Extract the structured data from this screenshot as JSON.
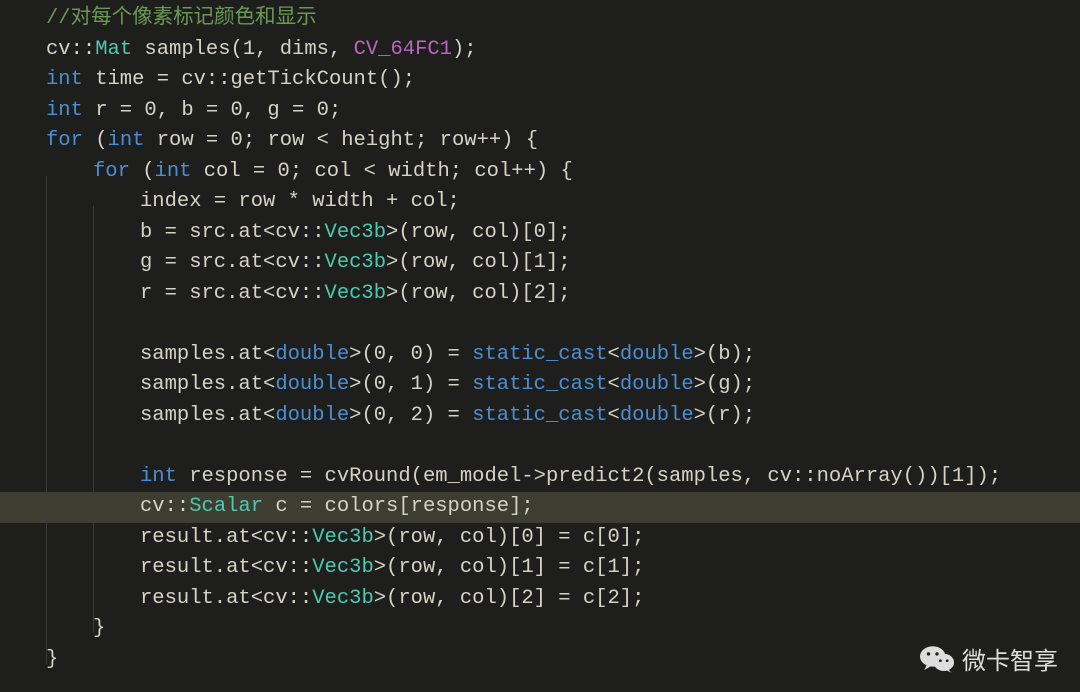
{
  "watermark": "微卡智享",
  "lines": [
    {
      "indent": 1,
      "hl": false,
      "segs": [
        {
          "c": "tok-comment",
          "t": "//对每个像素标记颜色和显示"
        }
      ]
    },
    {
      "indent": 1,
      "hl": false,
      "segs": [
        {
          "c": "tok-default",
          "t": "cv::"
        },
        {
          "c": "tok-type",
          "t": "Mat"
        },
        {
          "c": "tok-default",
          "t": " samples(1, dims, "
        },
        {
          "c": "tok-const",
          "t": "CV_64FC1"
        },
        {
          "c": "tok-default",
          "t": ");"
        }
      ]
    },
    {
      "indent": 1,
      "hl": false,
      "segs": [
        {
          "c": "tok-keyword",
          "t": "int"
        },
        {
          "c": "tok-default",
          "t": " time = cv::getTickCount();"
        }
      ]
    },
    {
      "indent": 1,
      "hl": false,
      "segs": [
        {
          "c": "tok-keyword",
          "t": "int"
        },
        {
          "c": "tok-default",
          "t": " r = 0, b = 0, g = 0;"
        }
      ]
    },
    {
      "indent": 1,
      "hl": false,
      "segs": [
        {
          "c": "tok-keyword",
          "t": "for"
        },
        {
          "c": "tok-default",
          "t": " ("
        },
        {
          "c": "tok-keyword",
          "t": "int"
        },
        {
          "c": "tok-default",
          "t": " row = 0; row < height; row++) {"
        }
      ]
    },
    {
      "indent": 2,
      "hl": false,
      "segs": [
        {
          "c": "tok-keyword",
          "t": "for"
        },
        {
          "c": "tok-default",
          "t": " ("
        },
        {
          "c": "tok-keyword",
          "t": "int"
        },
        {
          "c": "tok-default",
          "t": " col = 0; col < width; col++) {"
        }
      ]
    },
    {
      "indent": 3,
      "hl": false,
      "segs": [
        {
          "c": "tok-default",
          "t": "index = row * width + col;"
        }
      ]
    },
    {
      "indent": 3,
      "hl": false,
      "segs": [
        {
          "c": "tok-default",
          "t": "b = src.at<cv::"
        },
        {
          "c": "tok-type",
          "t": "Vec3b"
        },
        {
          "c": "tok-default",
          "t": ">(row, col)[0];"
        }
      ]
    },
    {
      "indent": 3,
      "hl": false,
      "segs": [
        {
          "c": "tok-default",
          "t": "g = src.at<cv::"
        },
        {
          "c": "tok-type",
          "t": "Vec3b"
        },
        {
          "c": "tok-default",
          "t": ">(row, col)[1];"
        }
      ]
    },
    {
      "indent": 3,
      "hl": false,
      "segs": [
        {
          "c": "tok-default",
          "t": "r = src.at<cv::"
        },
        {
          "c": "tok-type",
          "t": "Vec3b"
        },
        {
          "c": "tok-default",
          "t": ">(row, col)[2];"
        }
      ]
    },
    {
      "indent": 3,
      "hl": false,
      "segs": []
    },
    {
      "indent": 3,
      "hl": false,
      "segs": [
        {
          "c": "tok-default",
          "t": "samples.at<"
        },
        {
          "c": "tok-keyword",
          "t": "double"
        },
        {
          "c": "tok-default",
          "t": ">(0, 0) = "
        },
        {
          "c": "tok-keyword",
          "t": "static_cast"
        },
        {
          "c": "tok-default",
          "t": "<"
        },
        {
          "c": "tok-keyword",
          "t": "double"
        },
        {
          "c": "tok-default",
          "t": ">(b);"
        }
      ]
    },
    {
      "indent": 3,
      "hl": false,
      "segs": [
        {
          "c": "tok-default",
          "t": "samples.at<"
        },
        {
          "c": "tok-keyword",
          "t": "double"
        },
        {
          "c": "tok-default",
          "t": ">(0, 1) = "
        },
        {
          "c": "tok-keyword",
          "t": "static_cast"
        },
        {
          "c": "tok-default",
          "t": "<"
        },
        {
          "c": "tok-keyword",
          "t": "double"
        },
        {
          "c": "tok-default",
          "t": ">(g);"
        }
      ]
    },
    {
      "indent": 3,
      "hl": false,
      "segs": [
        {
          "c": "tok-default",
          "t": "samples.at<"
        },
        {
          "c": "tok-keyword",
          "t": "double"
        },
        {
          "c": "tok-default",
          "t": ">(0, 2) = "
        },
        {
          "c": "tok-keyword",
          "t": "static_cast"
        },
        {
          "c": "tok-default",
          "t": "<"
        },
        {
          "c": "tok-keyword",
          "t": "double"
        },
        {
          "c": "tok-default",
          "t": ">(r);"
        }
      ]
    },
    {
      "indent": 3,
      "hl": false,
      "segs": []
    },
    {
      "indent": 3,
      "hl": false,
      "segs": [
        {
          "c": "tok-keyword",
          "t": "int"
        },
        {
          "c": "tok-default",
          "t": " response = cvRound(em_model->predict2(samples, cv::noArray())[1]);"
        }
      ]
    },
    {
      "indent": 3,
      "hl": true,
      "segs": [
        {
          "c": "tok-default",
          "t": "cv::"
        },
        {
          "c": "tok-type",
          "t": "Scalar"
        },
        {
          "c": "tok-default",
          "t": " c = colors[response];"
        }
      ]
    },
    {
      "indent": 3,
      "hl": false,
      "segs": [
        {
          "c": "tok-default",
          "t": "result.at<cv::"
        },
        {
          "c": "tok-type",
          "t": "Vec3b"
        },
        {
          "c": "tok-default",
          "t": ">(row, col)[0] = c[0];"
        }
      ]
    },
    {
      "indent": 3,
      "hl": false,
      "segs": [
        {
          "c": "tok-default",
          "t": "result.at<cv::"
        },
        {
          "c": "tok-type",
          "t": "Vec3b"
        },
        {
          "c": "tok-default",
          "t": ">(row, col)[1] = c[1];"
        }
      ]
    },
    {
      "indent": 3,
      "hl": false,
      "segs": [
        {
          "c": "tok-default",
          "t": "result.at<cv::"
        },
        {
          "c": "tok-type",
          "t": "Vec3b"
        },
        {
          "c": "tok-default",
          "t": ">(row, col)[2] = c[2];"
        }
      ]
    },
    {
      "indent": 2,
      "hl": false,
      "segs": [
        {
          "c": "tok-default",
          "t": "}"
        }
      ]
    },
    {
      "indent": 1,
      "hl": false,
      "segs": [
        {
          "c": "tok-default",
          "t": "}"
        }
      ]
    }
  ]
}
